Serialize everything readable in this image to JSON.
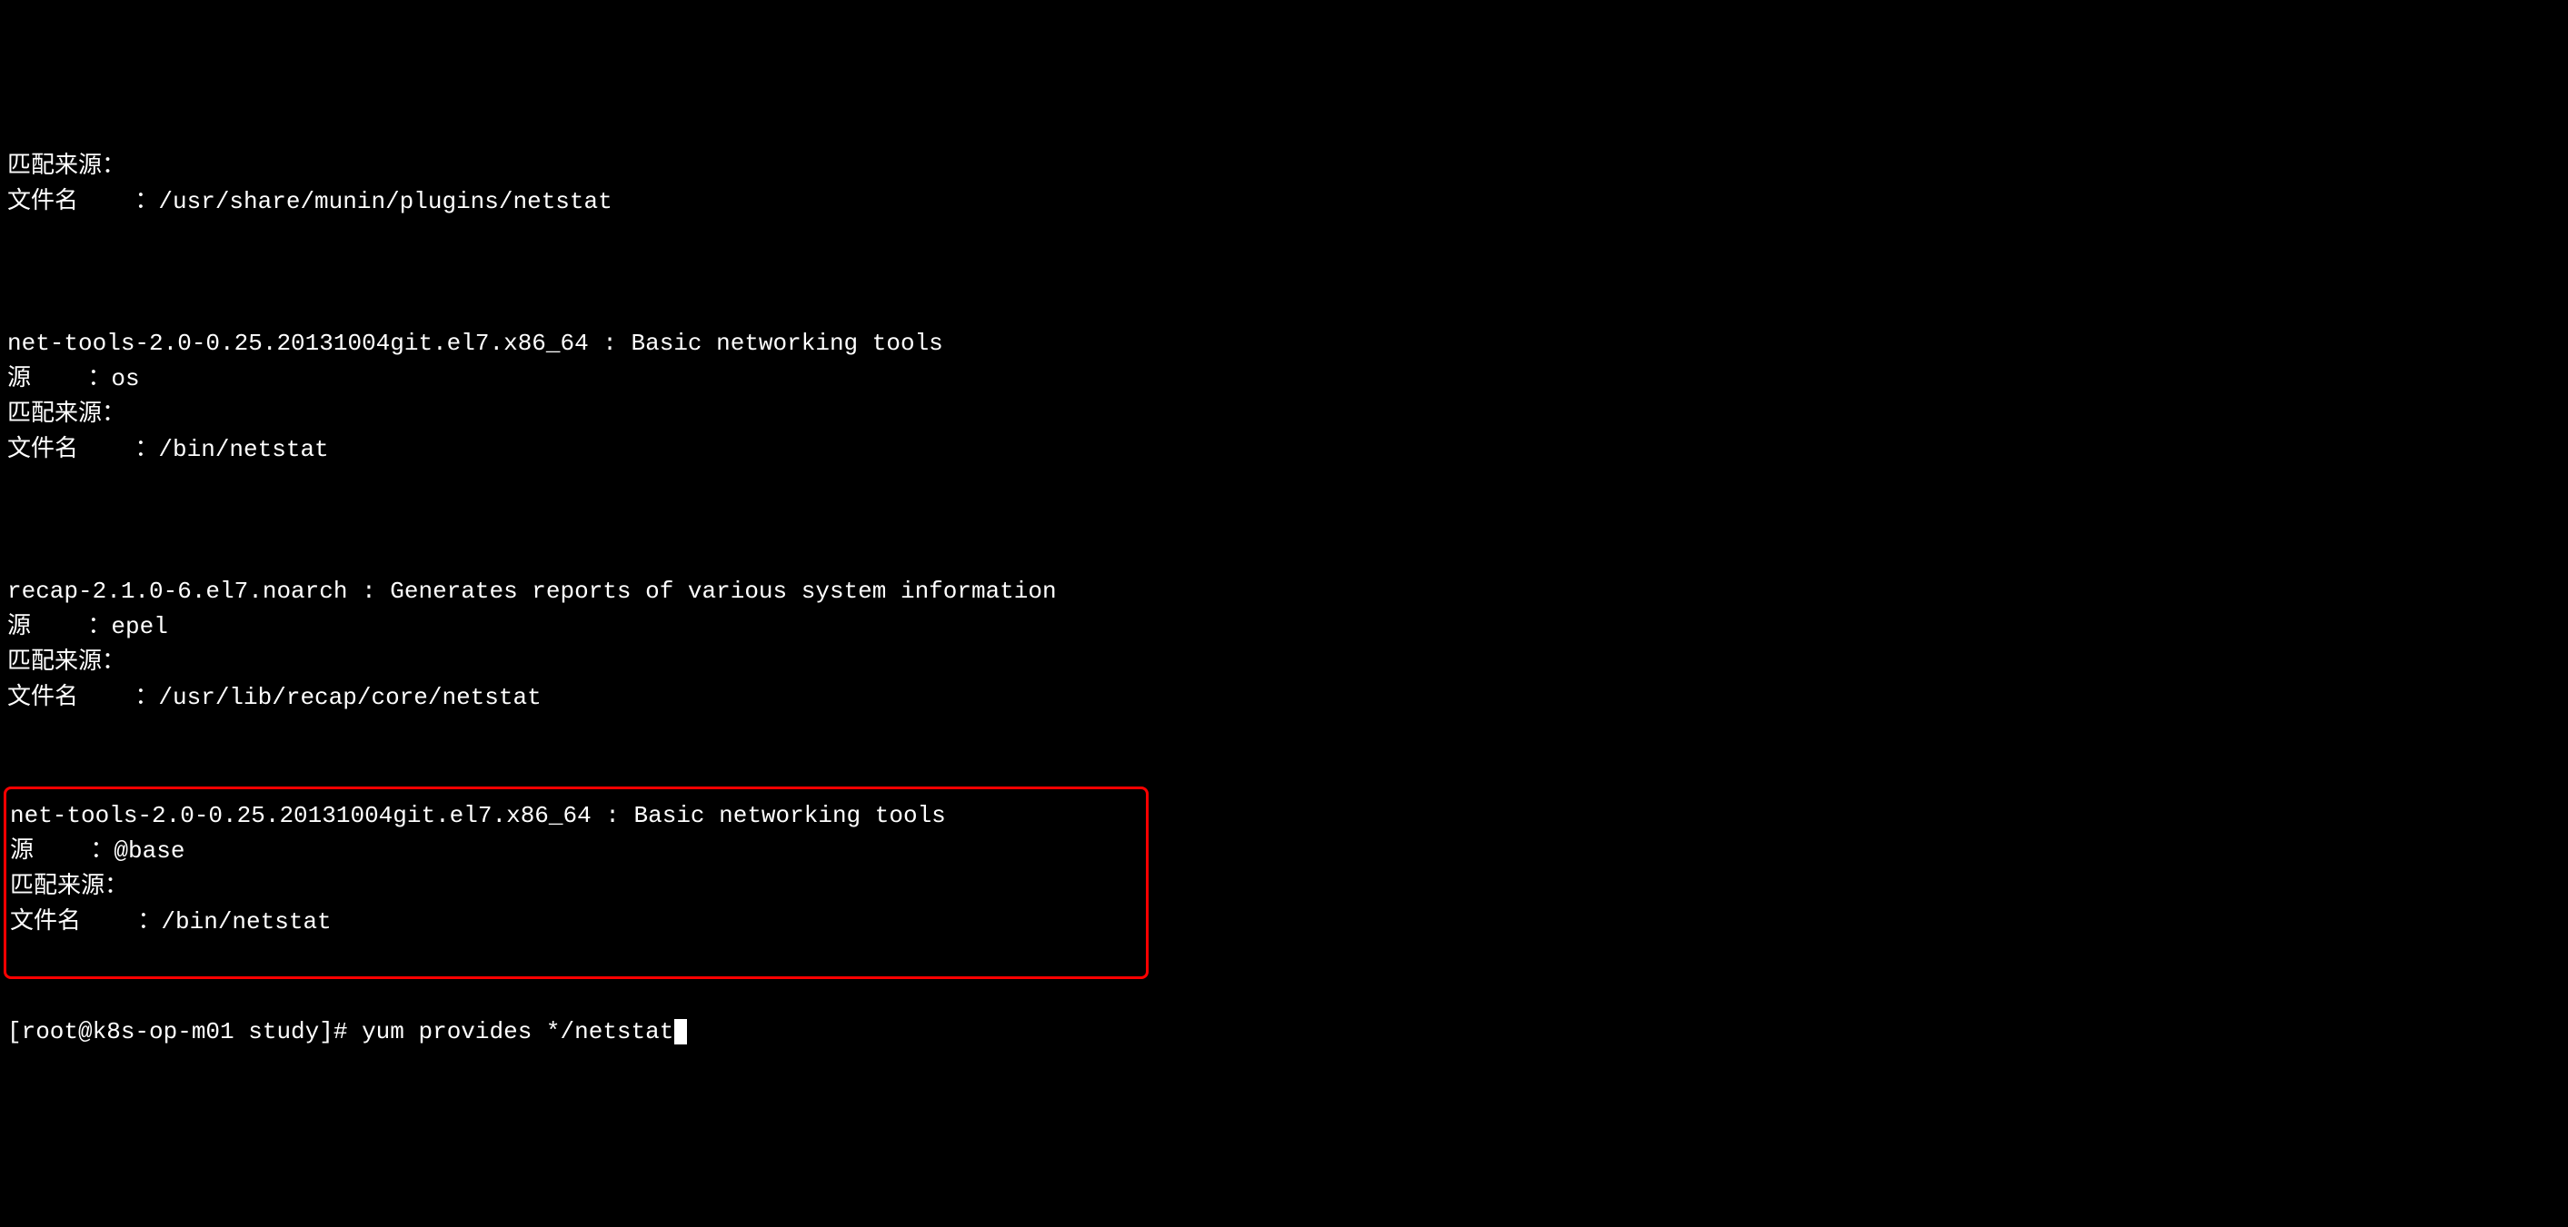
{
  "blocks": [
    {
      "match_from": "匹配来源：",
      "filename_label": "文件名    ：",
      "filename_value": "/usr/share/munin/plugins/netstat"
    },
    {
      "package": "net-tools-2.0-0.25.20131004git.el7.x86_64 : Basic networking tools",
      "source_label": "源    ：",
      "source_value": "os",
      "match_from": "匹配来源：",
      "filename_label": "文件名    ：",
      "filename_value": "/bin/netstat"
    },
    {
      "package": "recap-2.1.0-6.el7.noarch : Generates reports of various system information",
      "source_label": "源    ：",
      "source_value": "epel",
      "match_from": "匹配来源：",
      "filename_label": "文件名    ：",
      "filename_value": "/usr/lib/recap/core/netstat"
    },
    {
      "package": "net-tools-2.0-0.25.20131004git.el7.x86_64 : Basic networking tools",
      "source_label": "源    ：",
      "source_value": "@base",
      "match_from": "匹配来源：",
      "filename_label": "文件名    ：",
      "filename_value": "/bin/netstat",
      "highlighted": true
    }
  ],
  "prompt": {
    "user_host": "[root@k8s-op-m01 study]#",
    "command": "yum provides */netstat"
  }
}
